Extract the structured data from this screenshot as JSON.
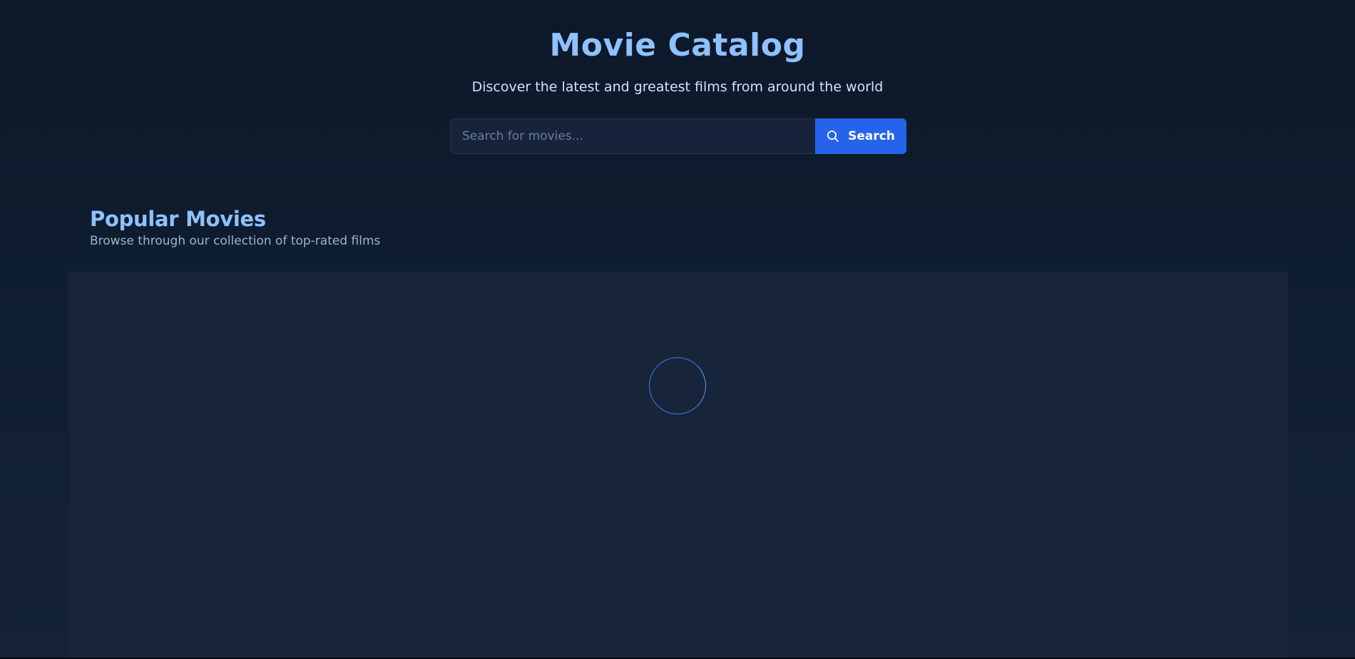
{
  "header": {
    "title": "Movie Catalog",
    "subtitle": "Discover the latest and greatest films from around the world"
  },
  "search": {
    "placeholder": "Search for movies...",
    "value": "",
    "button_label": "Search",
    "button_icon": "search-icon"
  },
  "section": {
    "title": "Popular Movies",
    "subtitle": "Browse through our collection of top-rated films"
  },
  "status": {
    "loading": true,
    "indicator_icon": "spinner-icon"
  },
  "colors": {
    "accent": "#2563eb",
    "title": "#8ec1ff",
    "background": "#0f1d30",
    "panel": "#17243a"
  }
}
